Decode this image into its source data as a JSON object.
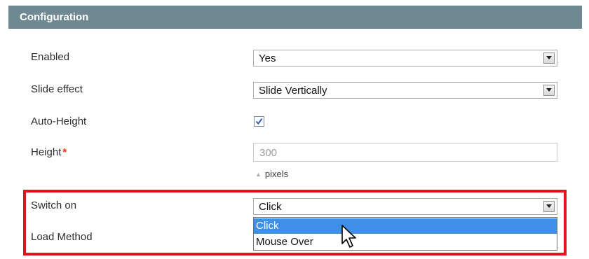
{
  "header": {
    "title": "Configuration"
  },
  "fields": {
    "enabled": {
      "label": "Enabled",
      "value": "Yes"
    },
    "slide_effect": {
      "label": "Slide effect",
      "value": "Slide Vertically"
    },
    "auto_height": {
      "label": "Auto-Height",
      "checked": true
    },
    "height": {
      "label": "Height",
      "required_marker": "*",
      "value": "300",
      "note": "pixels"
    },
    "switch_on": {
      "label": "Switch on",
      "value": "Click",
      "options": [
        "Click",
        "Mouse Over"
      ],
      "highlighted_option": "Click"
    },
    "load_method": {
      "label": "Load Method"
    }
  },
  "colors": {
    "header_bg": "#6f8992",
    "highlight_border": "#e1141c",
    "option_selected_bg": "#3e8fe6",
    "required": "#eb340a"
  },
  "icons": {
    "select_arrow": "chevron-down-icon",
    "checkbox_mark": "checkmark-icon",
    "note_marker": "triangle-up-icon",
    "cursor": "mouse-pointer-icon"
  }
}
